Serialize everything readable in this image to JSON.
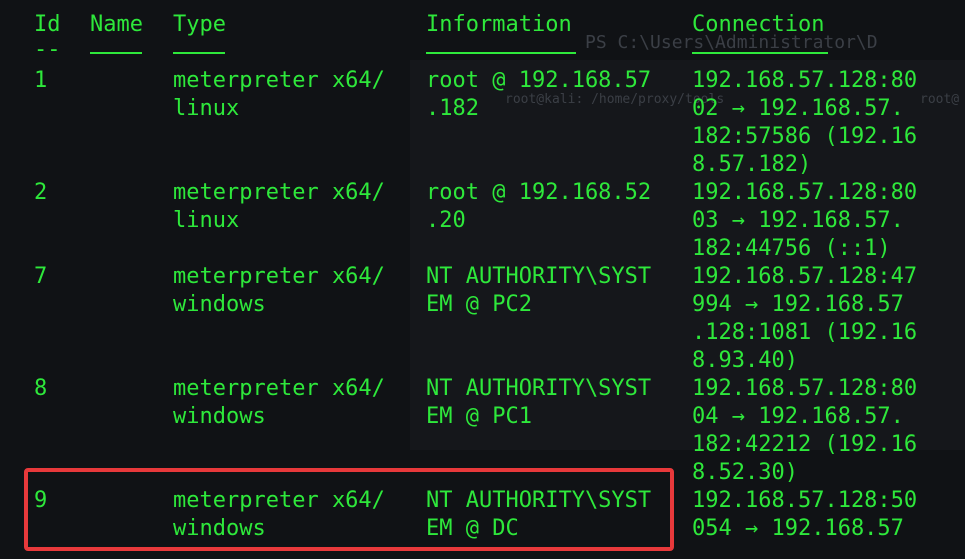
{
  "background_ghost": {
    "text1": "PS C:\\Users\\Administrator\\D",
    "text2": "root@kali: /home/proxy/tools",
    "text3": "root@"
  },
  "columns": {
    "id": "Id",
    "name": "Name",
    "type": "Type",
    "information": "Information",
    "connection": "Connection"
  },
  "underlines": {
    "id": "--"
  },
  "sessions": [
    {
      "id": "1",
      "type_lines": [
        "meterpreter x64/",
        "linux"
      ],
      "info_lines": [
        "root @ 192.168.57",
        ".182"
      ],
      "conn_lines": [
        "192.168.57.128:80",
        "02 → 192.168.57.",
        "182:57586 (192.16",
        "8.57.182)"
      ]
    },
    {
      "id": "2",
      "type_lines": [
        "meterpreter x64/",
        "linux"
      ],
      "info_lines": [
        "root @ 192.168.52",
        ".20"
      ],
      "conn_lines": [
        "192.168.57.128:80",
        "03 → 192.168.57.",
        "182:44756 (::1)"
      ]
    },
    {
      "id": "7",
      "type_lines": [
        "meterpreter x64/",
        "windows"
      ],
      "info_lines": [
        "NT AUTHORITY\\SYST",
        "EM @ PC2"
      ],
      "conn_lines": [
        "192.168.57.128:47",
        "994 → 192.168.57",
        ".128:1081 (192.16",
        "8.93.40)"
      ]
    },
    {
      "id": "8",
      "type_lines": [
        "meterpreter x64/",
        "windows"
      ],
      "info_lines": [
        "NT AUTHORITY\\SYST",
        "EM @ PC1"
      ],
      "conn_lines": [
        "192.168.57.128:80",
        "04 → 192.168.57.",
        "182:42212 (192.16",
        "8.52.30)"
      ]
    },
    {
      "id": "9",
      "type_lines": [
        "meterpreter x64/",
        "windows"
      ],
      "info_lines": [
        "NT AUTHORITY\\SYST",
        "EM @ DC"
      ],
      "conn_lines": [
        "192.168.57.128:50",
        "054 → 192.168.57"
      ]
    }
  ],
  "highlight_color": "#e8393b",
  "text_color": "#2ee83b"
}
